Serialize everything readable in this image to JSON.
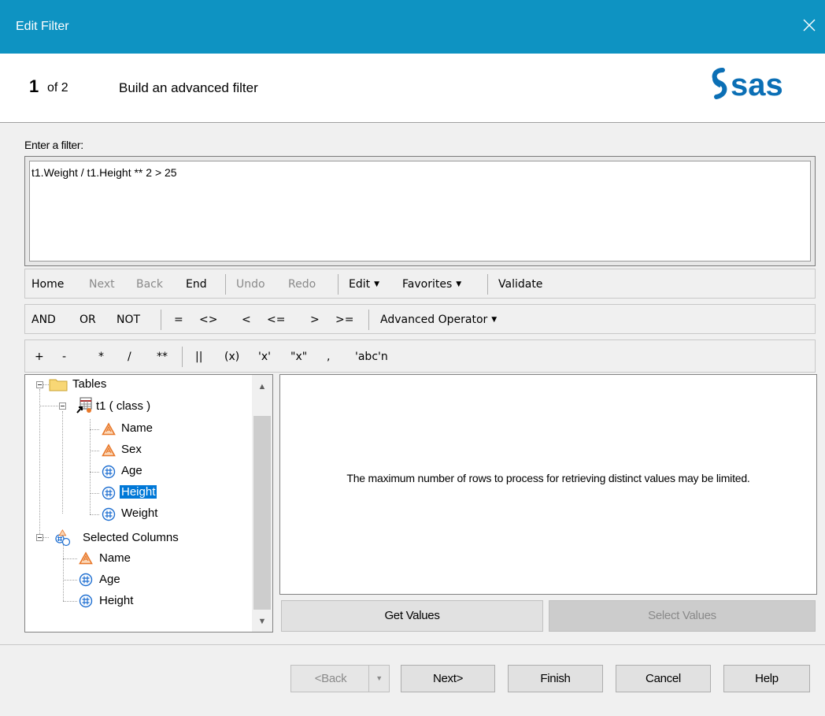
{
  "window": {
    "title": "Edit Filter",
    "close_icon": "close-icon"
  },
  "header": {
    "step": "1",
    "of": "of 2",
    "title": "Build an advanced filter",
    "logo_text": "sas"
  },
  "filter": {
    "label": "Enter a filter:",
    "value": "t1.Weight / t1.Height ** 2 > 25"
  },
  "toolbar1": {
    "home": "Home",
    "next": "Next",
    "back": "Back",
    "end": "End",
    "undo": "Undo",
    "redo": "Redo",
    "edit": "Edit",
    "favorites": "Favorites",
    "validate": "Validate"
  },
  "toolbar2": {
    "and": "AND",
    "or": "OR",
    "not": "NOT",
    "eq": "=",
    "ne": "<>",
    "lt": "<",
    "le": "<=",
    "gt": ">",
    "ge": ">=",
    "advanced": "Advanced Operator"
  },
  "toolbar3": {
    "plus": "+",
    "minus": "-",
    "times": "*",
    "divide": "/",
    "power": "**",
    "concat": "||",
    "paren": "(x)",
    "squote": "'x'",
    "dquote": "\"x\"",
    "comma": ",",
    "nliteral": "'abc'n"
  },
  "tree": {
    "tables": "Tables",
    "table": "t1 ( class )",
    "columns": [
      "Name",
      "Sex",
      "Age",
      "Height",
      "Weight"
    ],
    "column_types": [
      "character",
      "character",
      "numeric",
      "numeric",
      "numeric"
    ],
    "selected_index": 3,
    "selected_root": "Selected Columns",
    "selected_columns": [
      "Name",
      "Age",
      "Height"
    ]
  },
  "values_panel": {
    "message": "The maximum number of rows to process for retrieving distinct values may be limited.",
    "get_values": "Get Values",
    "select_values": "Select Values"
  },
  "buttons": {
    "back": "<Back",
    "next": "Next>",
    "finish": "Finish",
    "cancel": "Cancel",
    "help": "Help"
  },
  "colors": {
    "titlebar": "#0e93c2",
    "selection": "#0078d7",
    "character_icon": "#e8782a",
    "numeric_icon": "#1f6fd1"
  }
}
